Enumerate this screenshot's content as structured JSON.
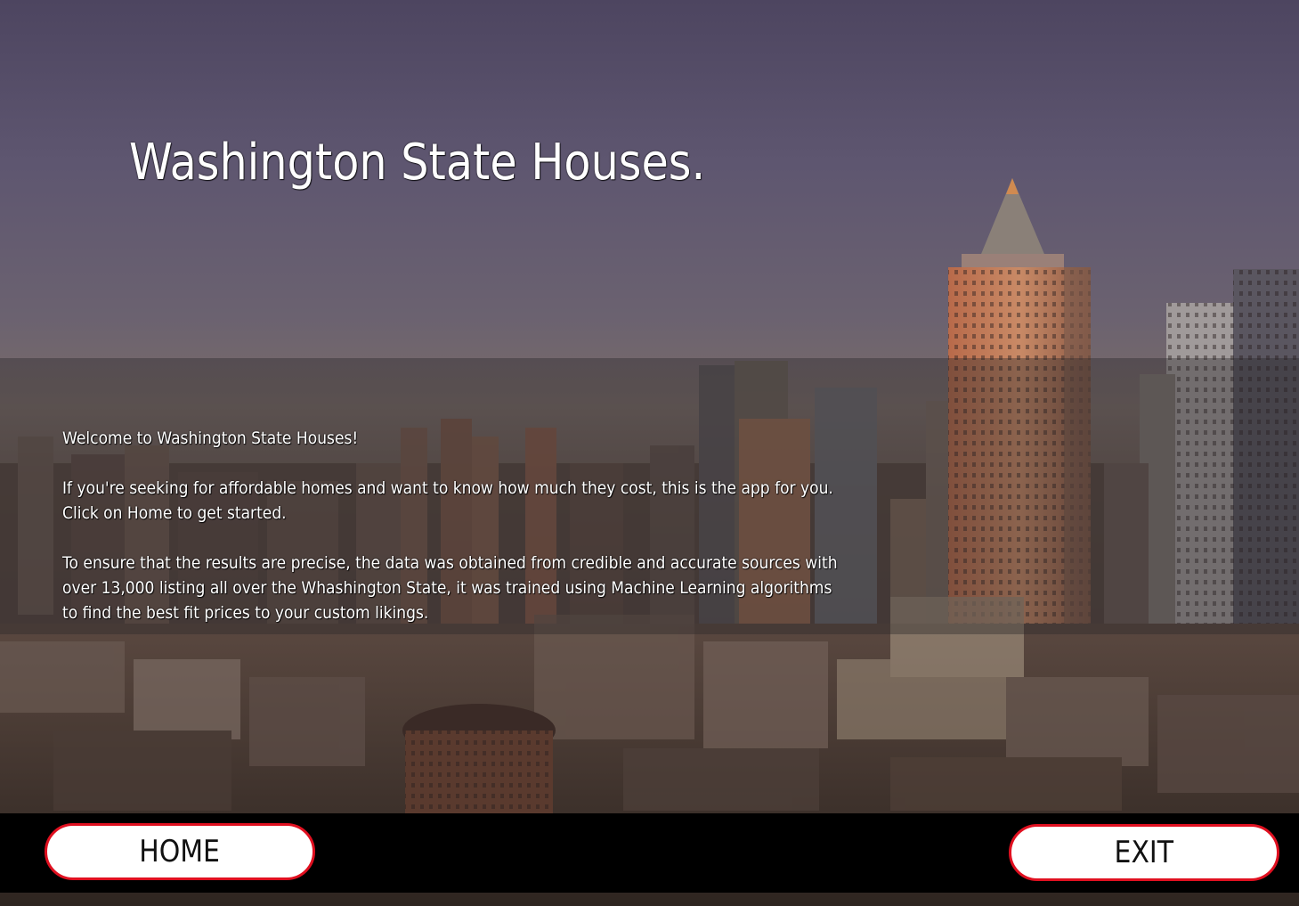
{
  "title": "Washington State Houses.",
  "intro": {
    "welcome": "Welcome to Washington State Houses!",
    "paragraph1": [
      "If you're seeking for affordable homes and want to know how much they cost, this is the app for you.",
      "Click on Home to get started."
    ],
    "paragraph2": [
      "To ensure that the results are precise, the data was obtained from credible and accurate sources with",
      "over 13,000 listing all over the Whashington State, it was trained using Machine Learning algorithms",
      "to find the best fit prices to your custom likings."
    ]
  },
  "footer": {
    "home_label": "HOME",
    "exit_label": "EXIT"
  },
  "colors": {
    "button_border": "#e01020",
    "footer_background": "#000000",
    "button_fill": "#ffffff"
  },
  "background": {
    "description_icon": "city-skyline-image"
  }
}
